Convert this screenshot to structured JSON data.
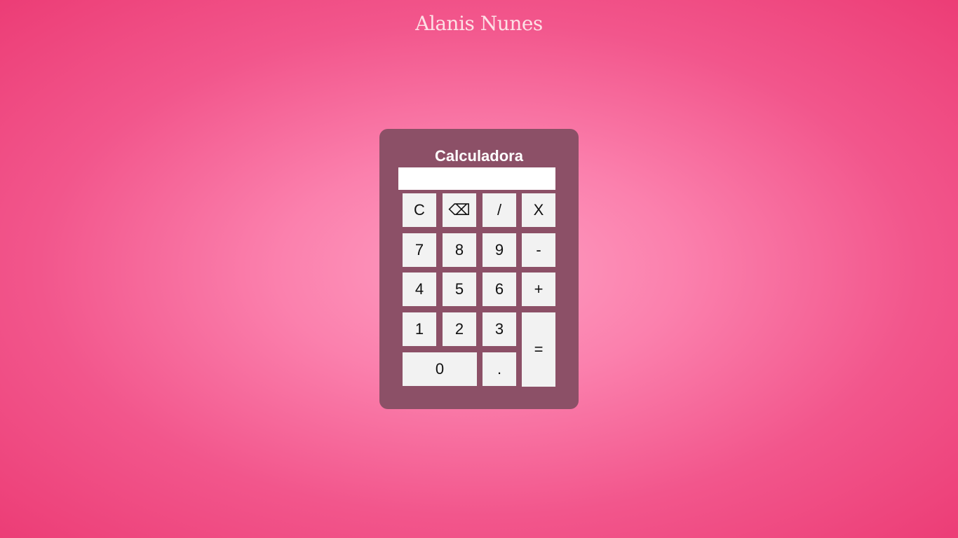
{
  "author": "Alanis Nunes",
  "calculator": {
    "title": "Calculadora",
    "display_value": "",
    "keys": {
      "clear": "C",
      "backspace": "⌫",
      "divide": "/",
      "multiply": "X",
      "seven": "7",
      "eight": "8",
      "nine": "9",
      "minus": "-",
      "four": "4",
      "five": "5",
      "six": "6",
      "plus": "+",
      "one": "1",
      "two": "2",
      "three": "3",
      "equals": "=",
      "zero": "0",
      "decimal": "."
    }
  },
  "colors": {
    "background_center": "#fd9dc1",
    "background_edge": "#ec3d76",
    "calculator_body": "#8c5067",
    "key_background": "#f2f2f2",
    "author_text": "#fde0e6"
  }
}
